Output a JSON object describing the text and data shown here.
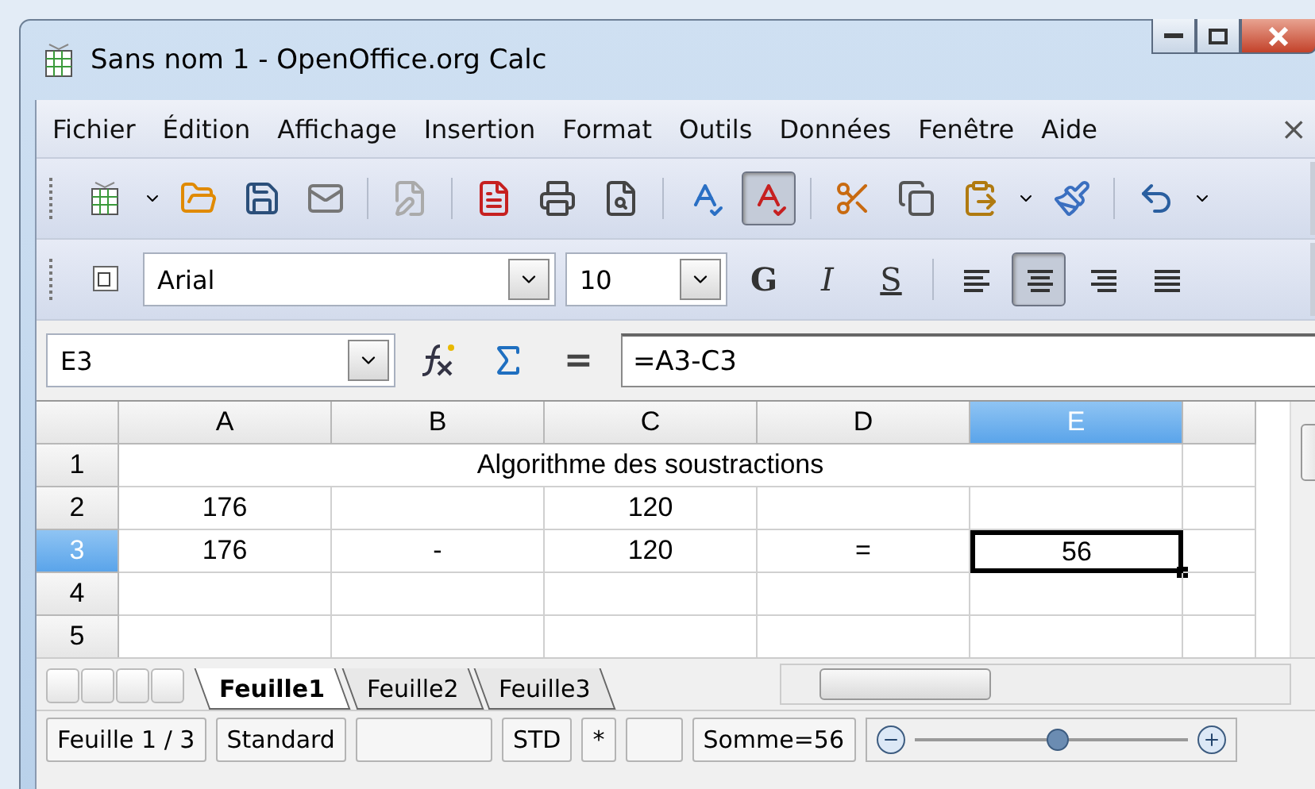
{
  "window": {
    "title": "Sans nom 1 - OpenOffice.org Calc"
  },
  "menu": [
    "Fichier",
    "Édition",
    "Affichage",
    "Insertion",
    "Format",
    "Outils",
    "Données",
    "Fenêtre",
    "Aide"
  ],
  "menu_close": "×",
  "standard_toolbar": {
    "autospell_on": true
  },
  "formatting_toolbar": {
    "font": "Arial",
    "size": "10",
    "bold": "G",
    "italic": "I",
    "shadow": "S",
    "align": [
      {
        "kind": "left",
        "selected": false
      },
      {
        "kind": "center",
        "selected": true
      },
      {
        "kind": "right",
        "selected": false
      },
      {
        "kind": "justify",
        "selected": false
      }
    ]
  },
  "formula_bar": {
    "name_box": "E3",
    "formula": "=A3-C3",
    "equals": "="
  },
  "columns": [
    {
      "label": "A",
      "selected": false
    },
    {
      "label": "B",
      "selected": false
    },
    {
      "label": "C",
      "selected": false
    },
    {
      "label": "D",
      "selected": false
    },
    {
      "label": "E",
      "selected": true
    }
  ],
  "rows": [
    {
      "label": "1",
      "selected": false,
      "kind": "title",
      "text": "Algorithme des soustractions"
    },
    {
      "label": "2",
      "selected": false,
      "kind": "values",
      "cells": [
        {
          "text": "176",
          "selected": false
        },
        {
          "selected": false
        },
        {
          "text": "120",
          "selected": false
        },
        {
          "selected": false
        },
        {
          "selected": false
        }
      ]
    },
    {
      "label": "3",
      "selected": true,
      "kind": "values",
      "cells": [
        {
          "text": "176",
          "selected": false
        },
        {
          "text": "-",
          "selected": false
        },
        {
          "text": "120",
          "selected": false
        },
        {
          "text": "=",
          "selected": false
        },
        {
          "text": "56",
          "selected": true
        }
      ]
    },
    {
      "label": "4",
      "selected": false,
      "kind": "values",
      "cells": [
        {
          "selected": false
        },
        {
          "selected": false
        },
        {
          "selected": false
        },
        {
          "selected": false
        },
        {
          "selected": false
        }
      ]
    },
    {
      "label": "5",
      "selected": false,
      "kind": "values",
      "cells": [
        {
          "selected": false
        },
        {
          "selected": false
        },
        {
          "selected": false
        },
        {
          "selected": false
        },
        {
          "selected": false
        }
      ]
    }
  ],
  "sheet_tabs": [
    {
      "label": "Feuille1",
      "selected": true
    },
    {
      "label": "Feuille2",
      "selected": false
    },
    {
      "label": "Feuille3",
      "selected": false
    }
  ],
  "status_bar": {
    "sheet": "Feuille 1 / 3",
    "style": "Standard",
    "mode": "STD",
    "modified": "*",
    "sum": "Somme=56",
    "zoom": {
      "level": 0.52
    }
  }
}
